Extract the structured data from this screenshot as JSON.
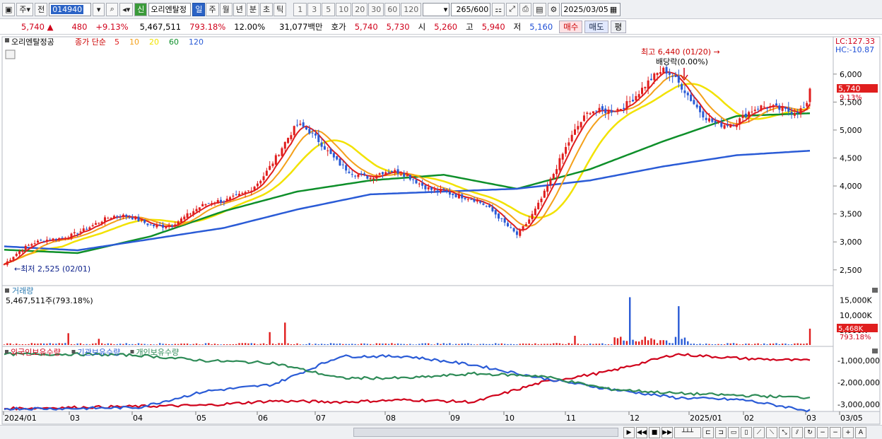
{
  "toolbar": {
    "market_label": "주",
    "prev_label": "전",
    "stock_code": "014940",
    "new_badge": "신",
    "stock_name": "오리엔탈정",
    "periods": [
      "일",
      "주",
      "월",
      "년",
      "분",
      "초",
      "틱"
    ],
    "period_active": "일",
    "intervals": [
      "1",
      "3",
      "5",
      "10",
      "20",
      "30",
      "60",
      "120"
    ],
    "count": "265",
    "count_max": "/600",
    "date": "2025/03/05"
  },
  "quote": {
    "price": "5,740",
    "arrow": "▲",
    "change": "480",
    "change_pct": "+9.13%",
    "volume": "5,467,511",
    "volume_pct": "793.18%",
    "turnover": "12.00%",
    "amount": "31,077백만",
    "bid_label": "호가",
    "ask": "5,740",
    "bid": "5,730",
    "open_label": "시",
    "open": "5,260",
    "high_label": "고",
    "high": "5,940",
    "low_label": "저",
    "low": "5,160",
    "buy_label": "매수",
    "sell_label": "매도",
    "eval_label": "평"
  },
  "price_panel": {
    "stock_name": "오리엔탈정공",
    "legend_title": "종가 단순",
    "ma_periods": [
      "5",
      "10",
      "20",
      "60",
      "120"
    ],
    "ma_colors": [
      "#e01e1e",
      "#f4a01a",
      "#f2e200",
      "#0e8f2a",
      "#2a5bd6"
    ],
    "lc_label": "LC:127.33",
    "hc_label": "HC:-10.87",
    "high_note": "최고 6,440 (01/20) →",
    "dividend_note": "배당락(0.00%)",
    "low_note": "←최저 2,525 (02/01)",
    "current_tag": "5,740",
    "current_pct": "9.13%",
    "y_ticks": [
      "6,000",
      "5,500",
      "5,000",
      "4,500",
      "4,000",
      "3,500",
      "3,000",
      "2,500"
    ]
  },
  "volume_panel": {
    "title": "거래량",
    "value_label": "5,467,511주(793.18%)",
    "y_ticks": [
      "15,000K",
      "10,000K",
      "5,000K"
    ],
    "current_tag": "5,468K",
    "current_pct": "793.18%"
  },
  "holding_panel": {
    "legend": [
      "외국인보유수량",
      "기관보유수량",
      "개인보유수량"
    ],
    "legend_colors": [
      "#d0021b",
      "#2a5bd6",
      "#2e8b57"
    ],
    "y_ticks": [
      "-1,000,000",
      "-2,000,000",
      "-3,000,000"
    ]
  },
  "x_axis": {
    "labels": [
      "2024/01",
      "03",
      "04",
      "05",
      "06",
      "07",
      "08",
      "09",
      "10",
      "11",
      "12",
      "2025/01",
      "02",
      "03",
      "03/05"
    ]
  },
  "chart_data": {
    "type": "candlestick",
    "title": "오리엔탈정공",
    "anchors_date": [
      "2024/01",
      "2024/03",
      "2024/05",
      "2024/07",
      "2024/08",
      "2024/09",
      "2024/10",
      "2024/11",
      "2024/12",
      "2025/01",
      "2025/02",
      "2025/03"
    ],
    "price_anchors": [
      2600,
      3150,
      3400,
      3800,
      4850,
      4000,
      4150,
      3300,
      5100,
      5750,
      5300,
      5740
    ],
    "ma120_anchors": [
      2920,
      2850,
      3050,
      3250,
      3580,
      3850,
      3900,
      3950,
      4100,
      4350,
      4550,
      4630
    ],
    "ma60_anchors": [
      2860,
      2800,
      3100,
      3550,
      3900,
      4100,
      4200,
      3950,
      4300,
      4800,
      5250,
      5300
    ],
    "high_label": "6,440 (01/20)",
    "low_label": "2,525 (02/01)"
  }
}
